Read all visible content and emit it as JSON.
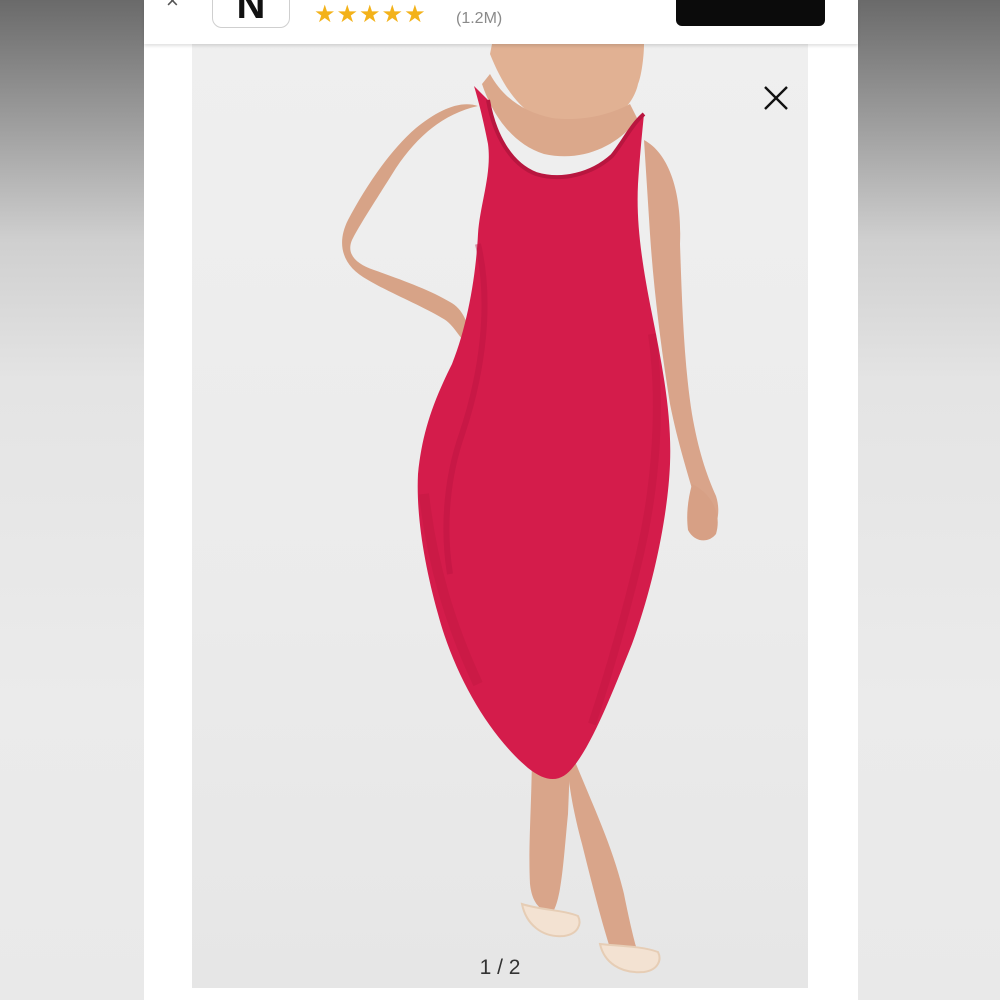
{
  "banner": {
    "close_icon": "close-icon",
    "app_icon_letter": "N",
    "rating_stars": 5,
    "rating_count": "(1.2M)",
    "get_button_label": ""
  },
  "viewer": {
    "counter": "1 / 2",
    "close_icon": "close-icon",
    "photo_subject": "product-photo-dress"
  },
  "colors": {
    "star": "#f3b21a",
    "dress": "#d41c4b",
    "button": "#0b0b0b"
  }
}
